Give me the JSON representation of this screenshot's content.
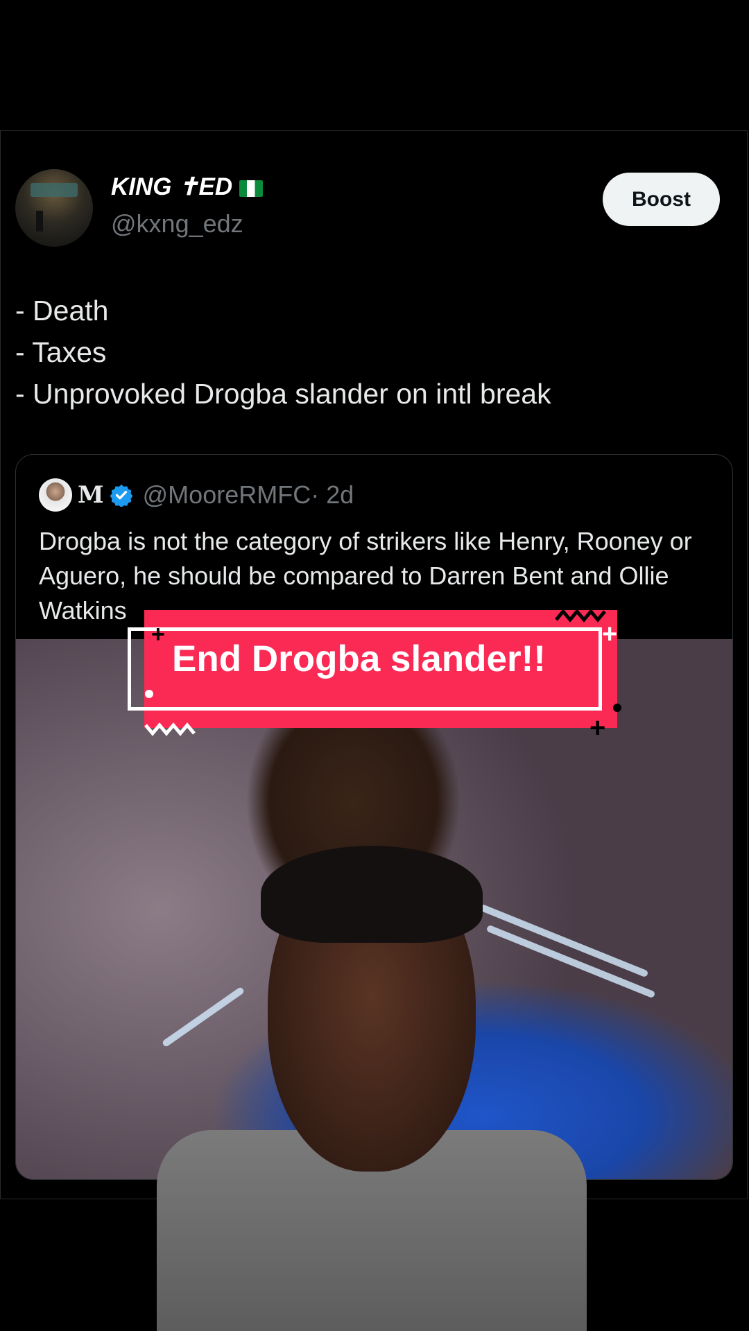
{
  "tweet": {
    "display_name": "KING ✝ED",
    "handle": "@kxng_edz",
    "boost_label": "Boost",
    "lines": [
      "- Death",
      "- Taxes",
      "- Unprovoked Drogba slander on intl break"
    ]
  },
  "quote": {
    "name": "M",
    "handle": "@MooreRMFC",
    "time": "· 2d",
    "text": "Drogba is not the category of strikers like Henry, Rooney or Aguero, he should be compared to Darren Bent and Ollie Watkins"
  },
  "overlay": {
    "banner_text": "End Drogba slander!!",
    "banner_color": "#fa2a55"
  },
  "colors": {
    "background": "#000000",
    "verified": "#1d9bf0",
    "muted_text": "#71767b"
  },
  "icons": [
    "verified-badge-icon",
    "nigeria-flag-icon"
  ]
}
